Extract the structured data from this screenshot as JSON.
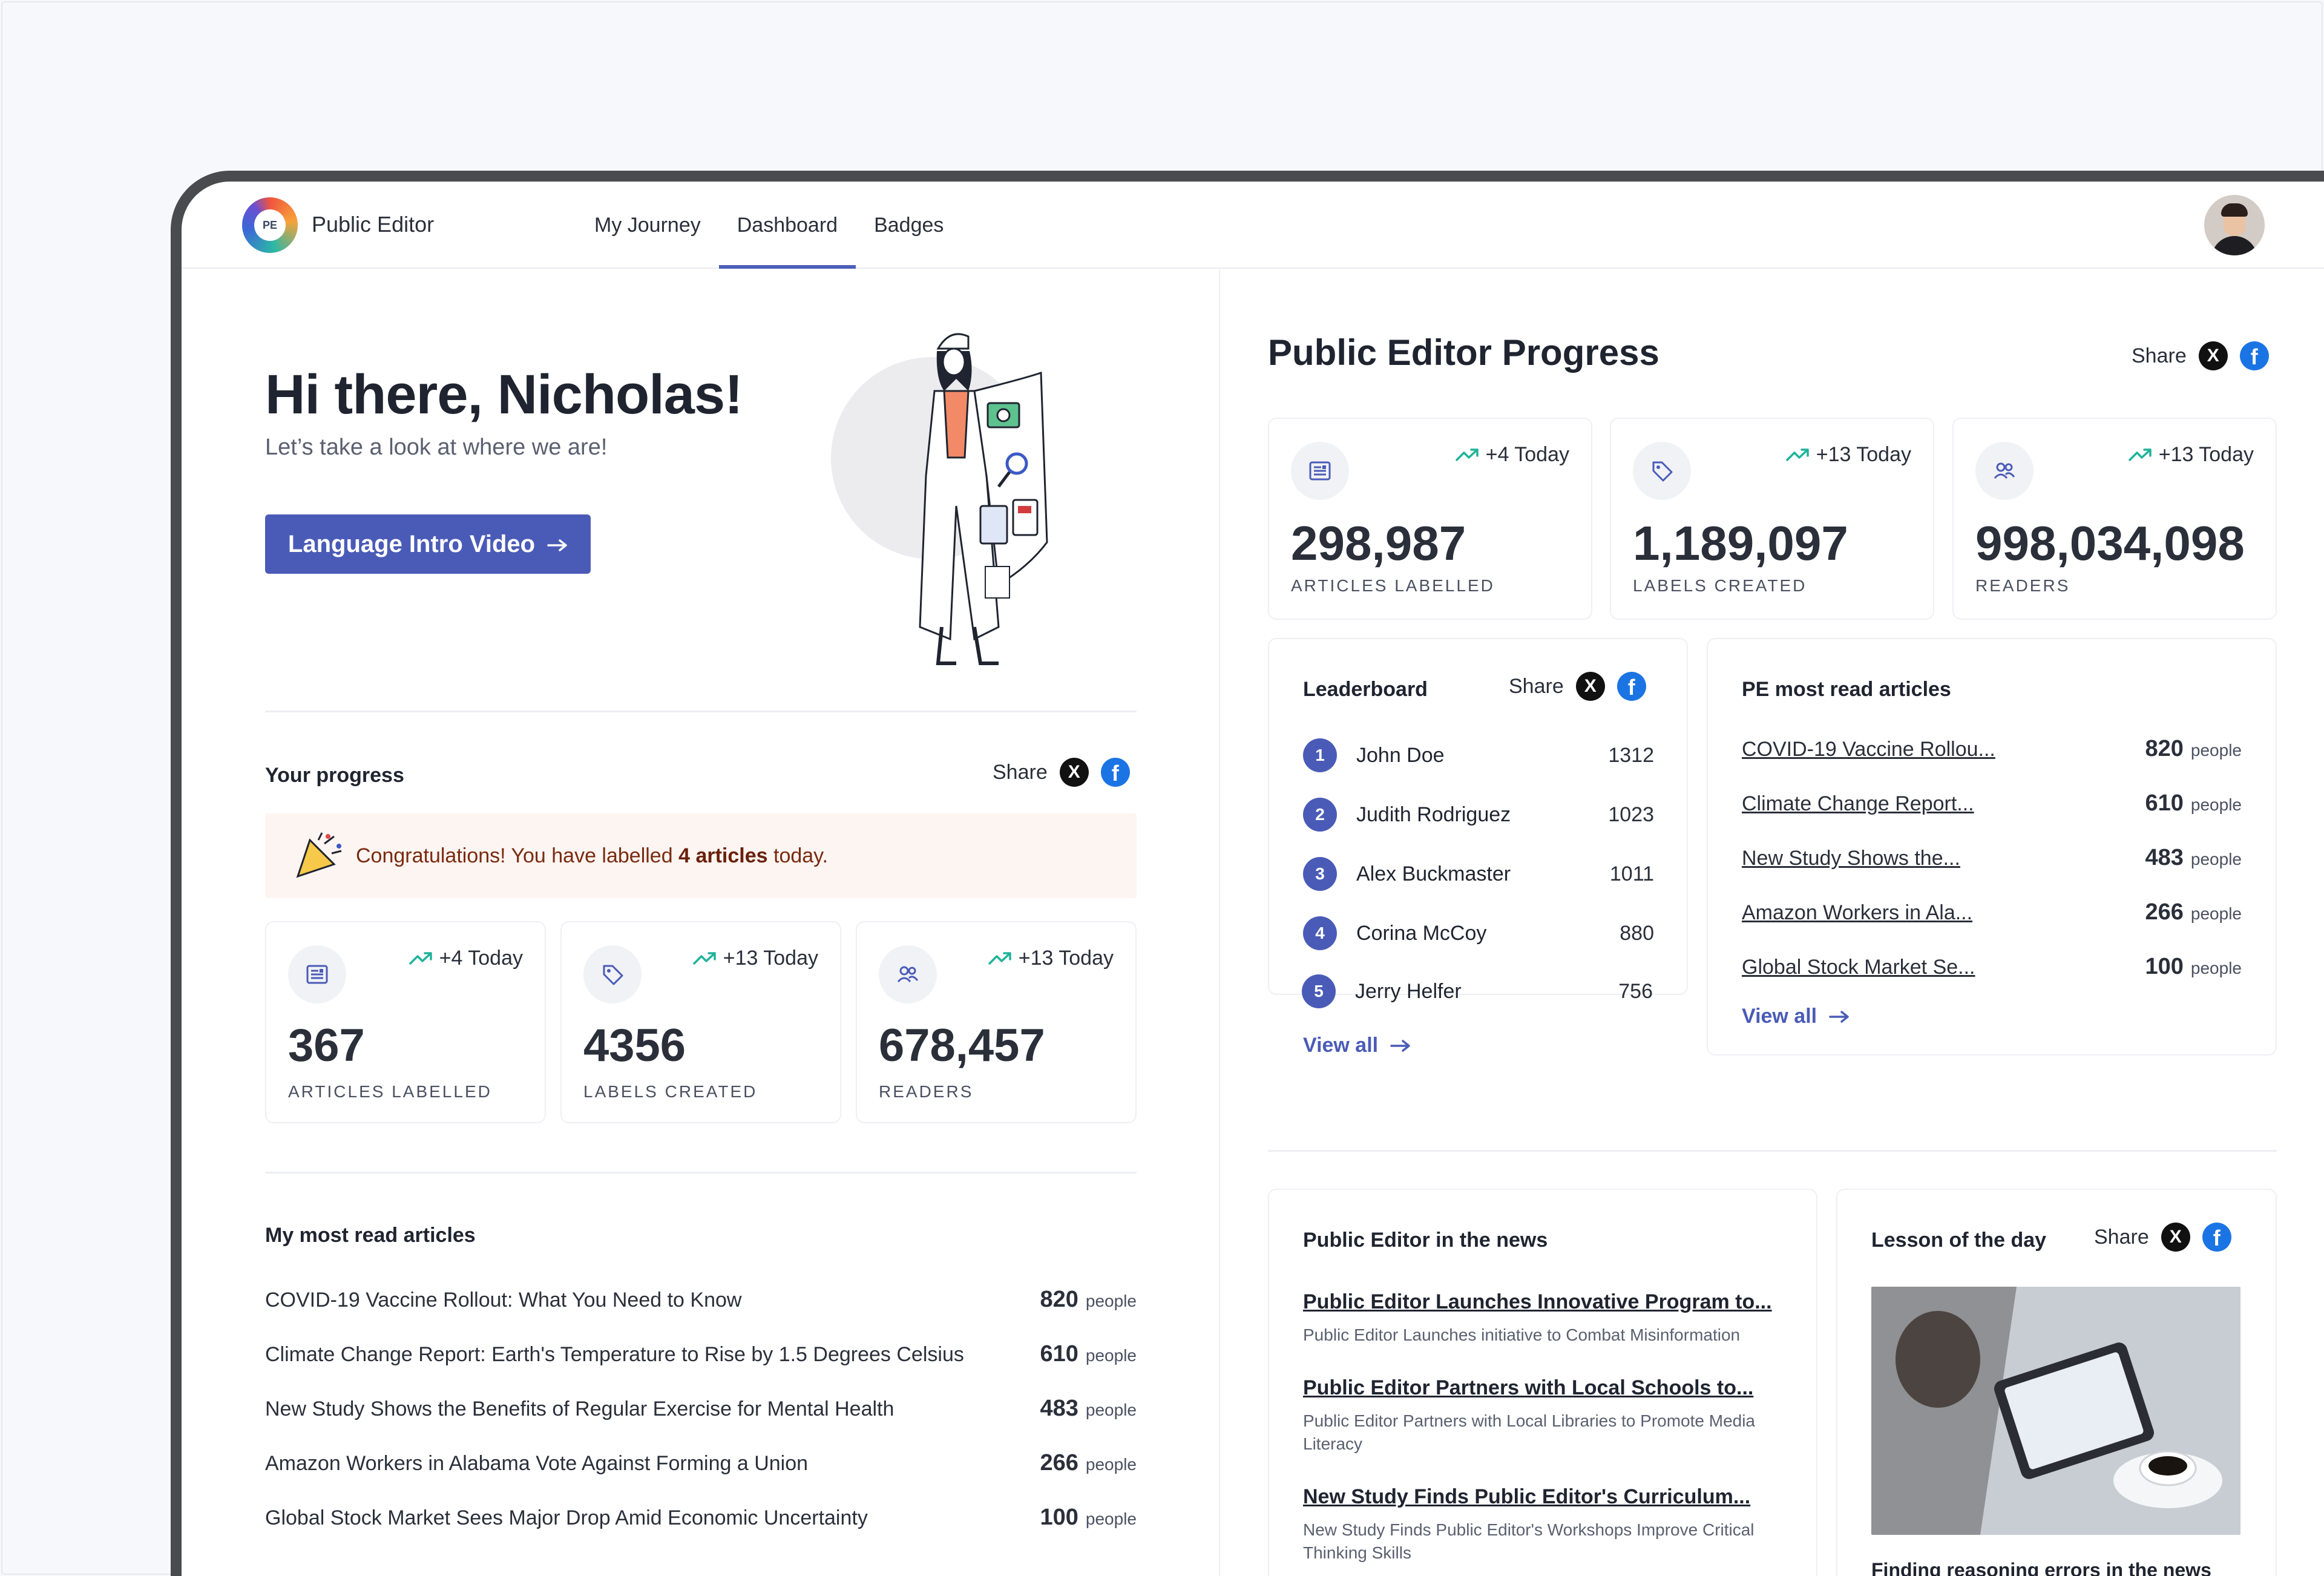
{
  "app": {
    "brand": "Public Editor",
    "logo_text": "PE"
  },
  "nav": {
    "items": [
      {
        "label": "My Journey"
      },
      {
        "label": "Dashboard"
      },
      {
        "label": "Badges"
      }
    ],
    "active": "Dashboard"
  },
  "greeting": {
    "title": "Hi there, Nicholas!",
    "subtitle": "Let’s take a look at where we are!",
    "button": "Language Intro Video"
  },
  "share_label": "Share",
  "social": {
    "x": "X",
    "fb": "f"
  },
  "your_progress": {
    "title": "Your progress",
    "congrats_prefix": "Congratulations! You have labelled",
    "congrats_bold": "4 articles",
    "congrats_suffix": "today.",
    "stats": [
      {
        "icon": "newspaper-icon",
        "trend": "+4 Today",
        "value": "367",
        "label": "ARTICLES LABELLED"
      },
      {
        "icon": "tag-icon",
        "trend": "+13 Today",
        "value": "4356",
        "label": "LABELS CREATED"
      },
      {
        "icon": "users-icon",
        "trend": "+13 Today",
        "value": "678,457",
        "label": "READERS"
      }
    ]
  },
  "my_articles": {
    "title": "My most read articles",
    "unit": "people",
    "items": [
      {
        "title": "COVID-19 Vaccine Rollout: What You Need to Know",
        "count": "820"
      },
      {
        "title": "Climate Change Report: Earth's Temperature to Rise by 1.5 Degrees Celsius",
        "count": "610"
      },
      {
        "title": "New Study Shows the Benefits of Regular Exercise for Mental Health",
        "count": "483"
      },
      {
        "title": "Amazon Workers in Alabama Vote Against Forming a Union",
        "count": "266"
      },
      {
        "title": "Global Stock Market Sees Major Drop Amid Economic Uncertainty",
        "count": "100"
      }
    ]
  },
  "pe_progress": {
    "title": "Public Editor Progress",
    "stats": [
      {
        "icon": "newspaper-icon",
        "trend": "+4 Today",
        "value": "298,987",
        "label": "ARTICLES LABELLED"
      },
      {
        "icon": "tag-icon",
        "trend": "+13 Today",
        "value": "1,189,097",
        "label": "LABELS CREATED"
      },
      {
        "icon": "users-icon",
        "trend": "+13 Today",
        "value": "998,034,098",
        "label": "READERS"
      }
    ]
  },
  "leaderboard": {
    "title": "Leaderboard",
    "view_all": "View all",
    "rows": [
      {
        "rank": "1",
        "name": "John Doe",
        "score": "1312"
      },
      {
        "rank": "2",
        "name": "Judith Rodriguez",
        "score": "1023"
      },
      {
        "rank": "3",
        "name": "Alex Buckmaster",
        "score": "1011"
      },
      {
        "rank": "4",
        "name": "Corina McCoy",
        "score": "880"
      },
      {
        "rank": "5",
        "name": "Jerry Helfer",
        "score": "756"
      }
    ]
  },
  "pe_articles": {
    "title": "PE most read articles",
    "unit": "people",
    "view_all": "View all",
    "items": [
      {
        "title": "COVID-19 Vaccine Rollou...",
        "count": "820"
      },
      {
        "title": "Climate Change Report...",
        "count": "610"
      },
      {
        "title": "New Study Shows the...",
        "count": "483"
      },
      {
        "title": "Amazon Workers in Ala...",
        "count": "266"
      },
      {
        "title": "Global Stock Market Se...",
        "count": "100"
      }
    ]
  },
  "news": {
    "title": "Public Editor in the news",
    "items": [
      {
        "title": "Public Editor Launches Innovative Program to...",
        "desc": "Public Editor Launches initiative to Combat Misinformation"
      },
      {
        "title": "Public Editor Partners with Local Schools to...",
        "desc": "Public Editor Partners with Local Libraries to Promote Media Literacy"
      },
      {
        "title": "New Study Finds Public Editor's Curriculum...",
        "desc": "New Study Finds Public Editor's Workshops Improve Critical Thinking Skills"
      }
    ]
  },
  "lesson": {
    "title": "Lesson of the day",
    "caption": "Finding reasoning errors in the news"
  },
  "colors": {
    "accent": "#4a5bb7",
    "trend": "#1fb39a",
    "x": "#111111",
    "facebook": "#1b74e4",
    "congrats_bg": "#fdf5f1"
  }
}
